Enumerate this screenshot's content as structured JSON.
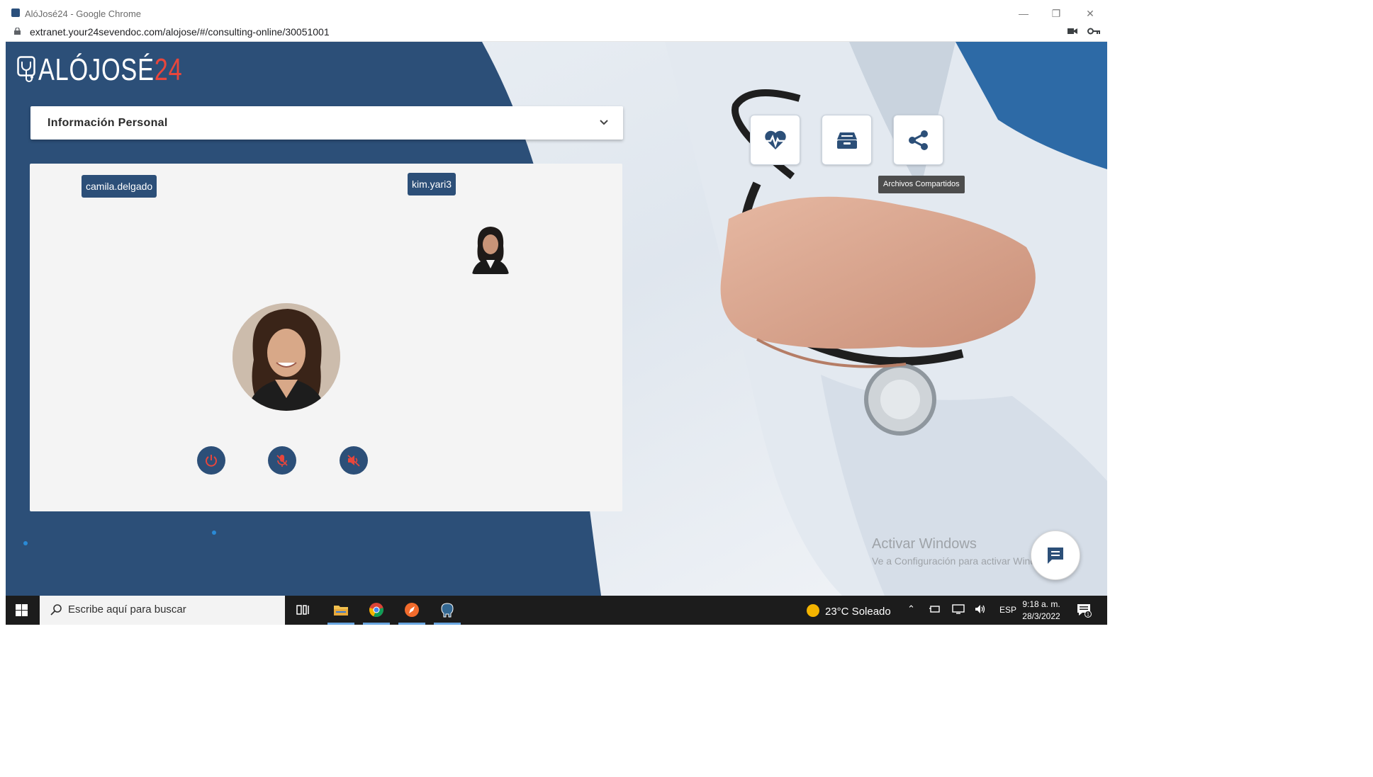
{
  "window": {
    "title": "AlóJosé24 - Google Chrome",
    "url": "extranet.your24sevendoc.com/alojose/#/consulting-online/30051001",
    "controls": [
      "minimize-icon",
      "restore-icon",
      "close-icon"
    ]
  },
  "app": {
    "logo_word": "ALÓJOSÉ",
    "logo_number": "24",
    "info_panel_label": "Información Personal",
    "local_user": "camila.delgado",
    "remote_user": "kim.yari3",
    "call_controls": [
      "power-icon",
      "mic-off-icon",
      "speaker-off-icon"
    ],
    "tools": [
      "heart-pulse-icon",
      "archive-icon",
      "share-icon"
    ],
    "tooltip": "Archivos Compartidos",
    "chat_button": "chat-icon"
  },
  "watermark": {
    "line1": "Activar Windows",
    "line2": "Ve a Configuración para activar Windows."
  },
  "taskbar": {
    "search_placeholder": "Escribe aquí para buscar",
    "weather": "23°C  Soleado",
    "language": "ESP",
    "time": "9:18 a. m.",
    "date": "28/3/2022",
    "notification_count": "1"
  },
  "colors": {
    "brand_navy": "#2c4f78",
    "brand_red": "#e8463c",
    "panel_bg": "#f4f4f4",
    "taskbar_bg": "#1c1c1c"
  }
}
